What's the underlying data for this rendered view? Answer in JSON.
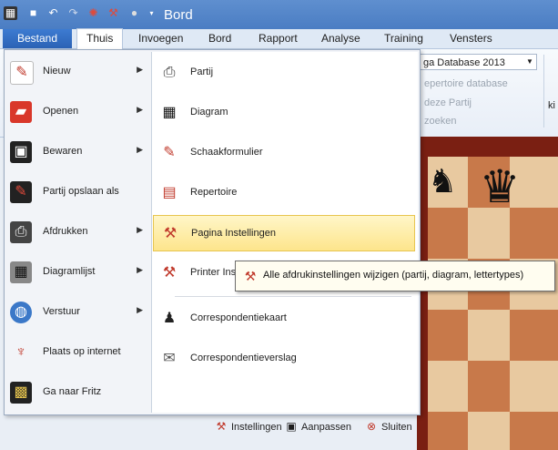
{
  "window": {
    "title": "Bord"
  },
  "quick_access": [
    {
      "icon": "board-icon"
    },
    {
      "icon": "save-icon"
    },
    {
      "icon": "undo-icon"
    },
    {
      "icon": "redo-icon"
    },
    {
      "icon": "engine-icon"
    },
    {
      "icon": "wrench-icon"
    },
    {
      "icon": "circle-icon"
    },
    {
      "icon": "dropdown-icon"
    }
  ],
  "ribbon_tabs": {
    "file": "Bestand",
    "tabs": [
      "Thuis",
      "Invoegen",
      "Bord",
      "Rapport",
      "Analyse",
      "Training",
      "Vensters"
    ],
    "active": "Thuis"
  },
  "ribbon": {
    "database_combo": "ga Database 2013",
    "items": [
      "epertoire database",
      "deze Partij",
      "zoeken"
    ],
    "right_text": "ki"
  },
  "file_menu": {
    "left_items": [
      {
        "label": "Nieuw",
        "icon": "new-icon",
        "submenu": true
      },
      {
        "label": "Openen",
        "icon": "folder-icon",
        "submenu": true
      },
      {
        "label": "Bewaren",
        "icon": "save-icon",
        "submenu": true
      },
      {
        "label": "Partij opslaan als",
        "icon": "save-as-icon",
        "submenu": false
      },
      {
        "label": "Afdrukken",
        "icon": "printer-icon",
        "submenu": true
      },
      {
        "label": "Diagramlijst",
        "icon": "diagram-list-icon",
        "submenu": true
      },
      {
        "label": "Verstuur",
        "icon": "globe-icon",
        "submenu": true
      },
      {
        "label": "Plaats op internet",
        "icon": "antenna-icon",
        "submenu": false
      },
      {
        "label": "Ga naar Fritz",
        "icon": "chip-icon",
        "submenu": false
      }
    ],
    "right_items": [
      {
        "label": "Partij",
        "icon": "print-game-icon"
      },
      {
        "label": "Diagram",
        "icon": "print-diagram-icon"
      },
      {
        "label": "Schaakformulier",
        "icon": "print-scoresheet-icon"
      },
      {
        "label": "Repertoire",
        "icon": "repertoire-file-icon"
      },
      {
        "label": "Pagina Instellingen",
        "icon": "page-setup-icon",
        "highlighted": true
      },
      {
        "label": "Printer Ins",
        "icon": "printer-setup-icon"
      },
      {
        "label": "Correspondentiekaart",
        "icon": "correspondence-card-icon"
      },
      {
        "label": "Correspondentieverslag",
        "icon": "correspondence-report-icon"
      }
    ],
    "bottom_buttons": [
      {
        "label": "Instellingen",
        "icon": "settings-icon"
      },
      {
        "label": "Aanpassen",
        "icon": "customize-icon"
      },
      {
        "label": "Sluiten",
        "icon": "close-icon"
      }
    ]
  },
  "tooltip": {
    "text": "Alle afdrukinstellingen wijzigen (partij, diagram, lettertypes)"
  },
  "colors": {
    "titlebar": "#4a7dc3",
    "file_tab": "#2b62b5",
    "highlight": "#fde58c",
    "board_dark": "#c8794a",
    "board_light": "#e8c9a0",
    "board_frame": "#7a1f12"
  }
}
